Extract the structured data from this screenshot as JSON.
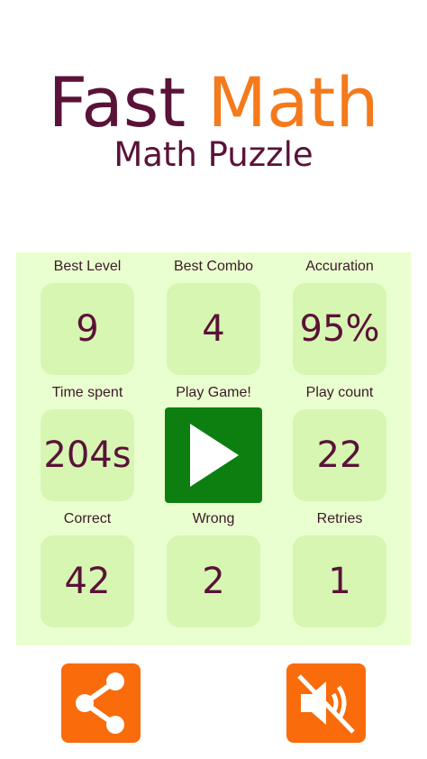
{
  "header": {
    "title_word1": "Fast",
    "title_word2": "Math",
    "subtitle": "Math Puzzle"
  },
  "stats": {
    "best_level": {
      "label": "Best Level",
      "value": "9"
    },
    "best_combo": {
      "label": "Best Combo",
      "value": "4"
    },
    "accuration": {
      "label": "Accuration",
      "value": "95%"
    },
    "time_spent": {
      "label": "Time spent",
      "value": "204s"
    },
    "play_count": {
      "label": "Play count",
      "value": "22"
    },
    "correct": {
      "label": "Correct",
      "value": "42"
    },
    "wrong": {
      "label": "Wrong",
      "value": "2"
    },
    "retries": {
      "label": "Retries",
      "value": "1"
    }
  },
  "play": {
    "label": "Play Game!",
    "icon": "play-icon"
  },
  "footer": {
    "share_icon": "share-icon",
    "sound_icon": "sound-muted-icon"
  },
  "colors": {
    "title_primary": "#5a1238",
    "title_accent": "#f47a1c",
    "panel_bg": "#eaffcf",
    "tile_bg": "#d6f6b2",
    "play_button": "#0c7f10",
    "footer_button": "#f96b0b"
  }
}
